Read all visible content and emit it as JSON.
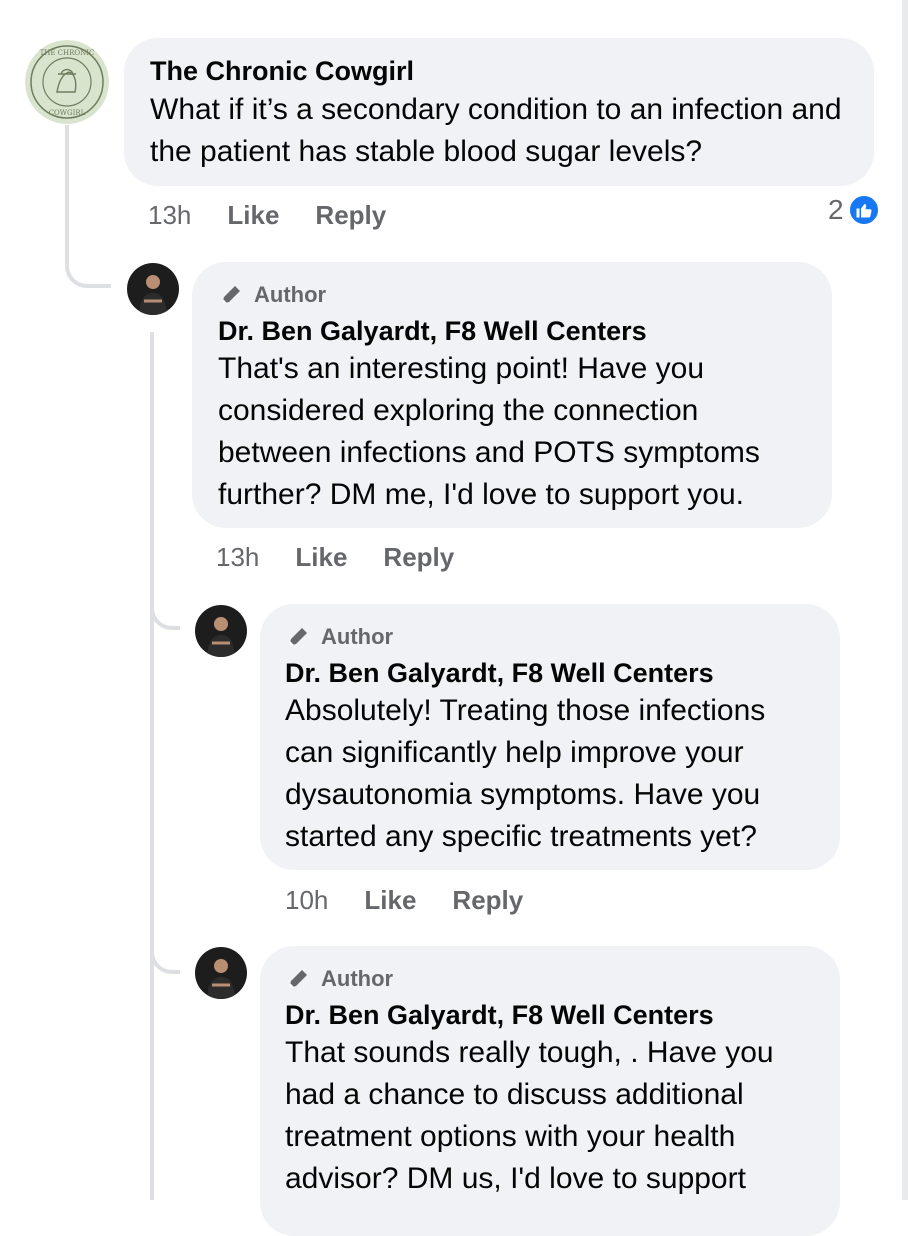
{
  "comments": [
    {
      "author": "The Chronic Cowgirl",
      "avatar_text_top": "THE CHRONIC",
      "avatar_text_bottom": "COWGIRL",
      "text": "What if it’s a secondary condition to an infection and the patient has stable blood sugar levels?",
      "time": "13h",
      "like_label": "Like",
      "reply_label": "Reply",
      "reaction_count": "2",
      "reaction_icon": "like-icon"
    },
    {
      "badge": "Author",
      "author": "Dr. Ben Galyardt, F8 Well Centers",
      "text": "That's an interesting point! Have you considered exploring the connection between infections and POTS symptoms further? DM me, I'd love to support you.",
      "time": "13h",
      "like_label": "Like",
      "reply_label": "Reply"
    },
    {
      "badge": "Author",
      "author": "Dr. Ben Galyardt, F8 Well Centers",
      "text": "Absolutely! Treating those infections can significantly help improve your dysautonomia symptoms. Have you started any specific treatments yet?",
      "time": "10h",
      "like_label": "Like",
      "reply_label": "Reply"
    },
    {
      "badge": "Author",
      "author": "Dr. Ben Galyardt, F8 Well Centers",
      "text": "That sounds really tough, . Have you had a chance to discuss additional treatment options with your health advisor? DM us, I'd love to support"
    }
  ],
  "colors": {
    "bubble_bg": "#f0f2f5",
    "muted_text": "#65676b",
    "like_blue": "#1877f2",
    "cowgirl_avatar_bg": "#d9e4cf"
  }
}
